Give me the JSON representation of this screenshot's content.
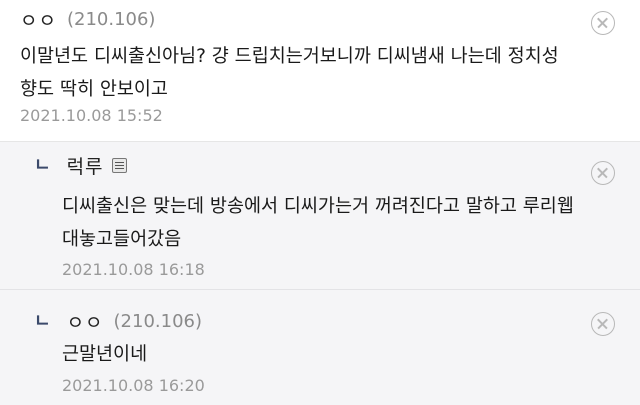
{
  "comments": [
    {
      "nickname": "ㅇㅇ",
      "ip": "(210.106)",
      "text_lines": [
        "이말년도 디씨출신아님? 걍 드립치는거보니까 디씨냄새 나는데 정치성",
        "향도 딱히 안보이고"
      ],
      "date": "2021.10.08 15:52",
      "reply": false
    },
    {
      "nickname": "럭루",
      "ip": "",
      "text_lines": [
        "디씨출신은 맞는데 방송에서 디씨가는거 꺼려진다고 말하고 루리웹",
        "대놓고들어갔음"
      ],
      "date": "2021.10.08 16:18",
      "reply": true,
      "reply_mark": "ㄴ",
      "user_icon": "fixed-nickname-icon"
    },
    {
      "nickname": "ㅇㅇ",
      "ip": "(210.106)",
      "text_lines": [
        "근말년이네"
      ],
      "date": "2021.10.08 16:20",
      "reply": true,
      "reply_mark": "ㄴ"
    }
  ],
  "icons": {
    "delete": "close-circle-icon",
    "reply": "reply-arrow-icon"
  },
  "colors": {
    "reply_background": "#f5f5f7",
    "reply_mark": "#3b4a6b",
    "ip_text": "#8a8a8a",
    "date_text": "#9a9a9a"
  }
}
